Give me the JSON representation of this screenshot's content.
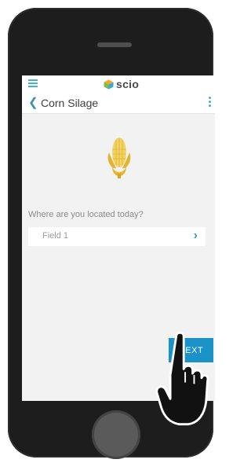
{
  "app": {
    "logo_text": "scio"
  },
  "header": {
    "title": "Corn Silage"
  },
  "main": {
    "question": "Where are you located today?",
    "location_value": "Field 1"
  },
  "footer": {
    "next_label": "NEXT"
  },
  "icons": {
    "menu": "menu-icon",
    "back": "chevron-left-icon",
    "more": "more-vertical-icon",
    "corn": "corn-icon",
    "chevron_right": "chevron-right-icon",
    "cursor": "hand-pointer-icon"
  },
  "colors": {
    "accent": "#4aaed0",
    "button": "#1b93c9",
    "corn": "#e9c94a"
  }
}
